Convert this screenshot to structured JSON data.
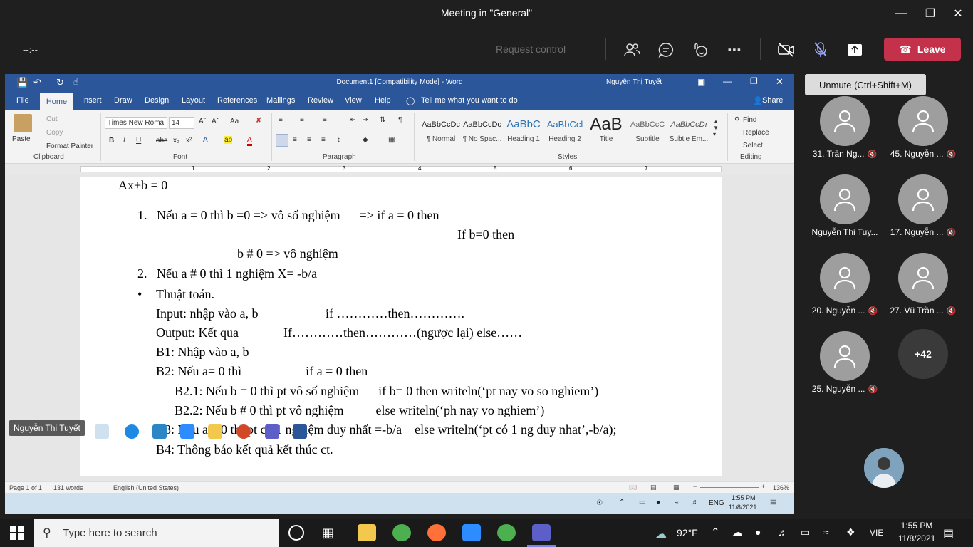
{
  "meeting": {
    "title": "Meeting in \"General\"",
    "timer": "--:--",
    "request_control": "Request control",
    "leave_label": "Leave",
    "tooltip": "Unmute (Ctrl+Shift+M)"
  },
  "participants": [
    {
      "name": "31. Trần Ng..."
    },
    {
      "name": "45. Nguyễn ..."
    },
    {
      "name": "Nguyễn Thị Tuy..."
    },
    {
      "name": "17. Nguyễn ..."
    },
    {
      "name": "20. Nguyễn ..."
    },
    {
      "name": "27. Vũ Trần ..."
    },
    {
      "name": "25. Nguyễn ..."
    }
  ],
  "more_count": "+42",
  "sharer_name": "Nguyễn Thị Tuyết",
  "word": {
    "title": "Document1 [Compatibility Mode] - Word",
    "user": "Nguyễn Thị Tuyết",
    "share": "Share",
    "tabs": [
      "File",
      "Home",
      "Insert",
      "Draw",
      "Design",
      "Layout",
      "References",
      "Mailings",
      "Review",
      "View",
      "Help"
    ],
    "tell_me": "Tell me what you want to do",
    "clipboard": {
      "paste": "Paste",
      "cut": "Cut",
      "copy": "Copy",
      "format_painter": "Format Painter",
      "group": "Clipboard"
    },
    "font": {
      "name": "Times New Roma",
      "size": "14",
      "group": "Font"
    },
    "paragraph_group": "Paragraph",
    "styles": [
      {
        "preview": "AaBbCcDc",
        "label": "¶ Normal"
      },
      {
        "preview": "AaBbCcDc",
        "label": "¶ No Spac..."
      },
      {
        "preview": "AaBbC",
        "label": "Heading 1"
      },
      {
        "preview": "AaBbCcl",
        "label": "Heading 2"
      },
      {
        "preview": "AaB",
        "label": "Title"
      },
      {
        "preview": "AaBbCcC",
        "label": "Subtitle"
      },
      {
        "preview": "AaBbCcDı",
        "label": "Subtle Em..."
      }
    ],
    "styles_group": "Styles",
    "editing": {
      "find": "Find",
      "replace": "Replace",
      "select": "Select",
      "group": "Editing"
    },
    "ruler": [
      "1",
      "2",
      "3",
      "4",
      "5",
      "6",
      "7"
    ],
    "doc_lines": [
      "Ax+b = 0",
      "1.   Nếu a = 0 thì b =0 => vô số nghiệm      => if a = 0 then",
      "If b=0 then",
      "b # 0 => vô nghiệm",
      "2.   Nếu a # 0 thì 1 nghiệm X= -b/a",
      "•",
      "Thuật toán.",
      "Input: nhập vào a, b                     if …………then………….",
      "Output: Kết qua              If…………then…………(ngược lại) else……",
      "B1: Nhập vào a, b",
      "B2: Nếu a= 0 thì                    if a = 0 then",
      "B2.1: Nếu b = 0 thì pt vô số nghiệm      if b= 0 then writeln(‘pt nay vo so nghiem’)",
      "B2.2: Nếu b # 0 thì pt vô nghiệm          else writeln(‘ph nay vo nghiem’)",
      "B3: Nếu a # 0 thì pt có 1 nghiệm duy nhất =-b/a    else writeln(‘pt có 1 ng duy nhat’,-b/a);",
      "B4: Thông báo kết quả kết thúc ct."
    ],
    "status": {
      "page": "Page 1 of 1",
      "words": "131 words",
      "language": "English (United States)",
      "zoom": "136%"
    },
    "inner_tray": {
      "lang": "ENG",
      "time": "1:55 PM",
      "date": "11/8/2021"
    }
  },
  "taskbar": {
    "search_placeholder": "Type here to search",
    "weather": "92°F",
    "lang": "VIE",
    "time": "1:55 PM",
    "date": "11/8/2021"
  },
  "colors": {
    "teams_bg": "#1f1f1f",
    "leave": "#c4314b",
    "word_blue": "#2b579a"
  }
}
